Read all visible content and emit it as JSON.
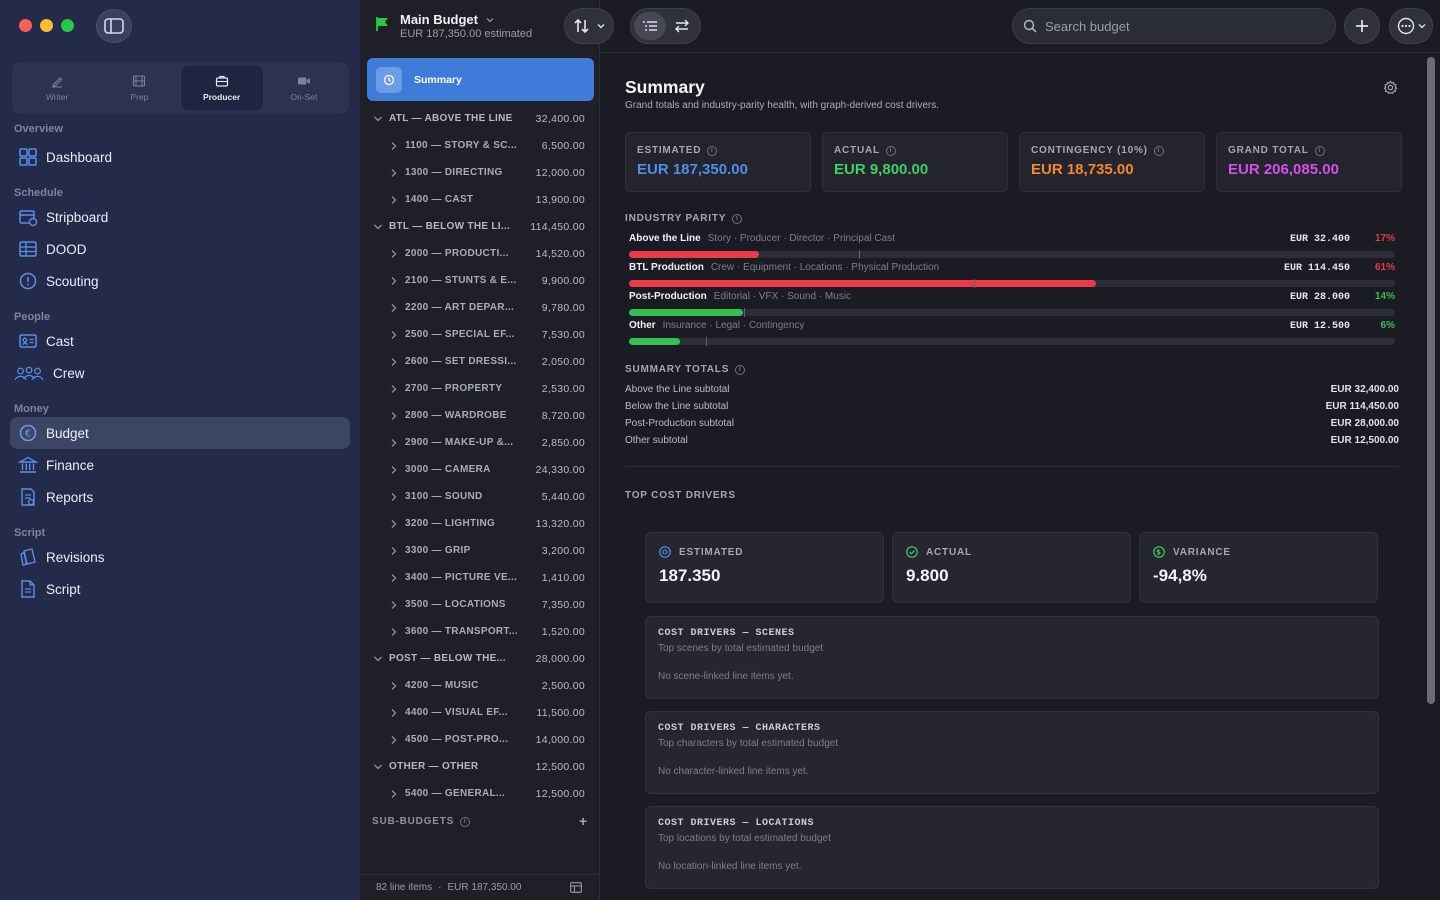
{
  "sidebar": {
    "modes": [
      {
        "label": "Writer",
        "icon": "pencil-icon"
      },
      {
        "label": "Prep",
        "icon": "film-icon"
      },
      {
        "label": "Producer",
        "icon": "briefcase-icon"
      },
      {
        "label": "On-Set",
        "icon": "camera-icon"
      }
    ],
    "active_mode": "Producer",
    "sections": {
      "overview": "Overview",
      "schedule": "Schedule",
      "people": "People",
      "money": "Money",
      "script": "Script"
    },
    "items": {
      "dashboard": "Dashboard",
      "stripboard": "Stripboard",
      "dood": "DOOD",
      "scouting": "Scouting",
      "cast": "Cast",
      "crew": "Crew",
      "budget": "Budget",
      "finance": "Finance",
      "reports": "Reports",
      "revisions": "Revisions",
      "script": "Script"
    }
  },
  "document": {
    "title": "Main Budget",
    "subtitle": "EUR 187,350.00 estimated"
  },
  "tree": {
    "summary_label": "Summary",
    "rows": [
      {
        "type": "group",
        "name": "ATL — ABOVE THE LINE",
        "amount": "32,400.00"
      },
      {
        "type": "child",
        "name": "1100 — STORY & SC...",
        "amount": "6,500.00"
      },
      {
        "type": "child",
        "name": "1300 — DIRECTING",
        "amount": "12,000.00"
      },
      {
        "type": "child",
        "name": "1400 — CAST",
        "amount": "13,900.00"
      },
      {
        "type": "group",
        "name": "BTL — BELOW THE LI...",
        "amount": "114,450.00"
      },
      {
        "type": "child",
        "name": "2000 — PRODUCTI...",
        "amount": "14,520.00"
      },
      {
        "type": "child",
        "name": "2100 — STUNTS & E...",
        "amount": "9,900.00"
      },
      {
        "type": "child",
        "name": "2200 — ART DEPAR...",
        "amount": "9,780.00"
      },
      {
        "type": "child",
        "name": "2500 — SPECIAL EF...",
        "amount": "7,530.00"
      },
      {
        "type": "child",
        "name": "2600 — SET DRESSI...",
        "amount": "2,050.00"
      },
      {
        "type": "child",
        "name": "2700 — PROPERTY",
        "amount": "2,530.00"
      },
      {
        "type": "child",
        "name": "2800 — WARDROBE",
        "amount": "8,720.00"
      },
      {
        "type": "child",
        "name": "2900 — MAKE-UP &...",
        "amount": "2,850.00"
      },
      {
        "type": "child",
        "name": "3000 — CAMERA",
        "amount": "24,330.00"
      },
      {
        "type": "child",
        "name": "3100 — SOUND",
        "amount": "5,440.00"
      },
      {
        "type": "child",
        "name": "3200 — LIGHTING",
        "amount": "13,320.00"
      },
      {
        "type": "child",
        "name": "3300 — GRIP",
        "amount": "3,200.00"
      },
      {
        "type": "child",
        "name": "3400 — PICTURE VE...",
        "amount": "1,410.00"
      },
      {
        "type": "child",
        "name": "3500 — LOCATIONS",
        "amount": "7,350.00"
      },
      {
        "type": "child",
        "name": "3600 — TRANSPORT...",
        "amount": "1,520.00"
      },
      {
        "type": "group",
        "name": "POST — BELOW THE...",
        "amount": "28,000.00"
      },
      {
        "type": "child",
        "name": "4200 — MUSIC",
        "amount": "2,500.00"
      },
      {
        "type": "child",
        "name": "4400 — VISUAL EF...",
        "amount": "11,500.00"
      },
      {
        "type": "child",
        "name": "4500 — POST-PRO...",
        "amount": "14,000.00"
      },
      {
        "type": "group",
        "name": "OTHER — OTHER",
        "amount": "12,500.00"
      },
      {
        "type": "child",
        "name": "5400 — GENERAL...",
        "amount": "12,500.00"
      }
    ],
    "subbudgets_label": "SUB-BUDGETS",
    "footer_count": "82 line items",
    "footer_total": "EUR 187,350.00"
  },
  "search": {
    "placeholder": "Search budget"
  },
  "summary": {
    "title": "Summary",
    "subtitle": "Grand totals and industry-parity health, with graph-derived cost drivers.",
    "cards": [
      {
        "label": "ESTIMATED",
        "value": "EUR 187,350.00",
        "color": "#4f8fe6"
      },
      {
        "label": "ACTUAL",
        "value": "EUR 9,800.00",
        "color": "#3fcf63"
      },
      {
        "label": "CONTINGENCY (10%)",
        "value": "EUR 18,735.00",
        "color": "#f08a2c"
      },
      {
        "label": "GRAND TOTAL",
        "value": "EUR 206,085.00",
        "color": "#d64fe8"
      }
    ],
    "parity_label": "INDUSTRY PARITY",
    "parity": [
      {
        "name": "Above the Line",
        "desc": "Story · Producer · Director · Principal Cast",
        "amount": "EUR 32.400",
        "pct": "17%",
        "fill": 0.17,
        "tick": 0.3,
        "color": "#ee3a46"
      },
      {
        "name": "BTL Production",
        "desc": "Crew · Equipment · Locations · Physical Production",
        "amount": "EUR 114.450",
        "pct": "61%",
        "fill": 0.61,
        "tick": 0.45,
        "color": "#ee3a46"
      },
      {
        "name": "Post-Production",
        "desc": "Editorial · VFX · Sound · Music",
        "amount": "EUR 28.000",
        "pct": "14%",
        "fill": 0.149,
        "tick": 0.15,
        "color": "#32c150"
      },
      {
        "name": "Other",
        "desc": "Insurance · Legal · Contingency",
        "amount": "EUR 12.500",
        "pct": "6%",
        "fill": 0.067,
        "tick": 0.1,
        "color": "#32c150"
      }
    ],
    "totals_label": "SUMMARY TOTALS",
    "totals": [
      {
        "label": "Above the Line subtotal",
        "value": "EUR 32,400.00"
      },
      {
        "label": "Below the Line subtotal",
        "value": "EUR 114,450.00"
      },
      {
        "label": "Post-Production subtotal",
        "value": "EUR 28,000.00"
      },
      {
        "label": "Other subtotal",
        "value": "EUR 12,500.00"
      }
    ],
    "drivers_label": "TOP COST DRIVERS",
    "stats": [
      {
        "label": "ESTIMATED",
        "value": "187.350",
        "icon_color": "#4f8fe6"
      },
      {
        "label": "ACTUAL",
        "value": "9.800",
        "icon_color": "#3fcf63"
      },
      {
        "label": "VARIANCE",
        "value": "-94,8%",
        "icon_color": "#3fcf63"
      }
    ],
    "drivers": [
      {
        "title": "COST DRIVERS — SCENES",
        "sub": "Top scenes by total estimated budget",
        "empty": "No scene-linked line items yet."
      },
      {
        "title": "COST DRIVERS — CHARACTERS",
        "sub": "Top characters by total estimated budget",
        "empty": "No character-linked line items yet."
      },
      {
        "title": "COST DRIVERS — LOCATIONS",
        "sub": "Top locations by total estimated budget",
        "empty": "No location-linked line items yet."
      }
    ]
  }
}
